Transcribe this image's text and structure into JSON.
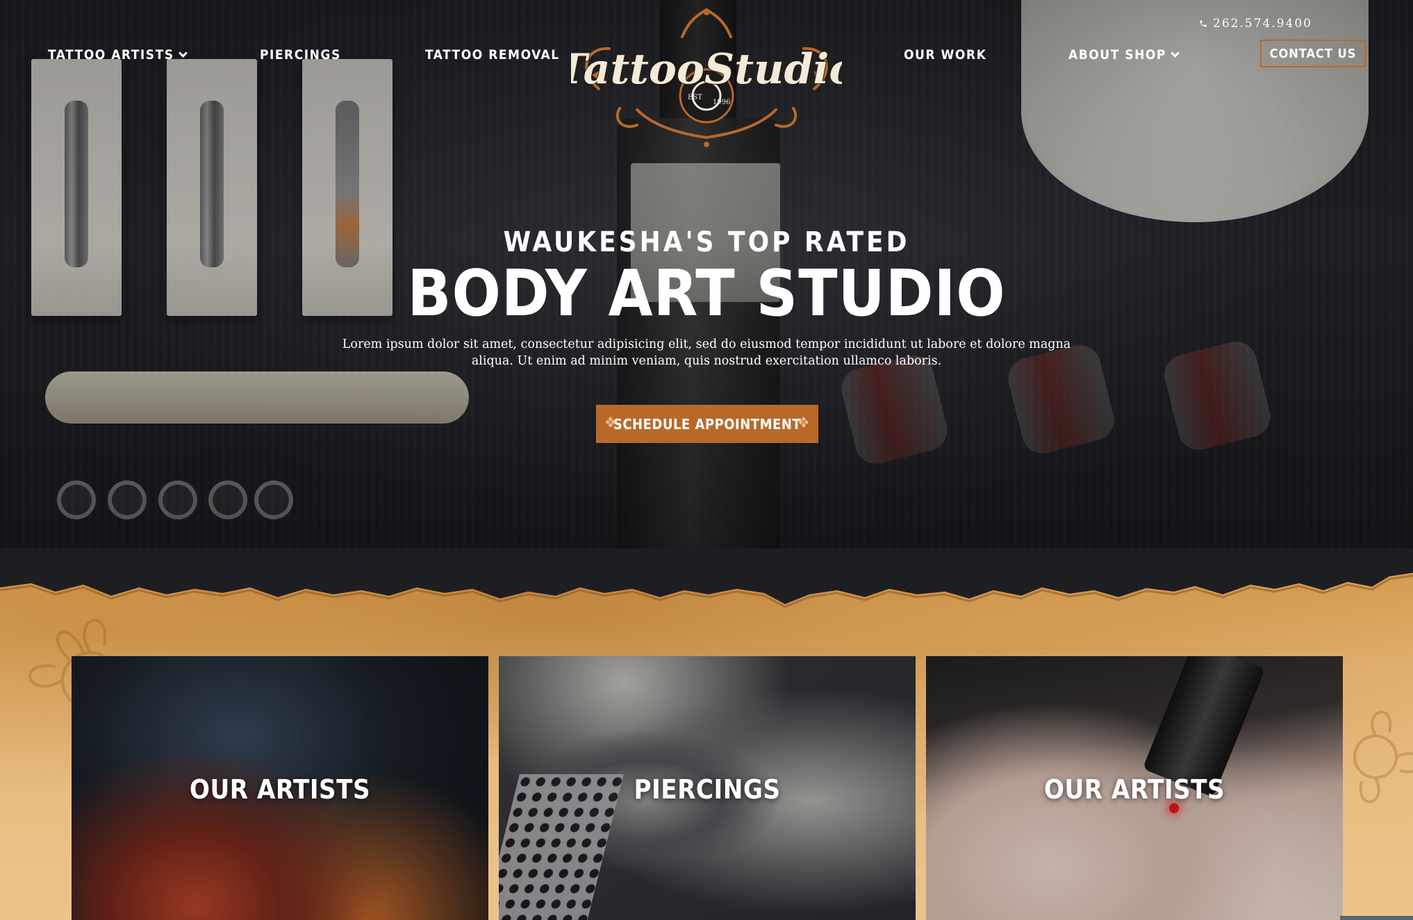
{
  "nav": {
    "left": [
      {
        "label": "TATTOO ARTISTS",
        "dropdown": true
      },
      {
        "label": "PIERCINGS",
        "dropdown": false
      },
      {
        "label": "TATTOO REMOVAL",
        "dropdown": false
      }
    ],
    "right": [
      {
        "label": "OUR WORK",
        "dropdown": false
      },
      {
        "label": "ABOUT SHOP",
        "dropdown": true
      }
    ],
    "phone": "262.574.9400",
    "phone_icon": "phone-icon",
    "contact_label": "CONTACT US"
  },
  "logo": {
    "wordmark": "TattooStudio",
    "est": "EST",
    "year": "1996"
  },
  "hero": {
    "eyebrow": "WAUKESHA'S TOP RATED",
    "headline": "BODY ART STUDIO",
    "lede": "Lorem ipsum dolor sit amet, consectetur adipisicing elit, sed do eiusmod tempor incididunt ut labore et dolore magna aliqua. Ut enim ad minim veniam, quis nostrud exercitation ullamco laboris.",
    "cta_label": "SCHEDULE APPOINTMENT"
  },
  "cards": [
    {
      "label": "OUR ARTISTS"
    },
    {
      "label": "PIERCINGS"
    },
    {
      "label": "OUR ARTISTS"
    }
  ],
  "colors": {
    "accent": "#b8692a",
    "parchment": "#e5b879",
    "hero_bg": "#1d1e22"
  }
}
